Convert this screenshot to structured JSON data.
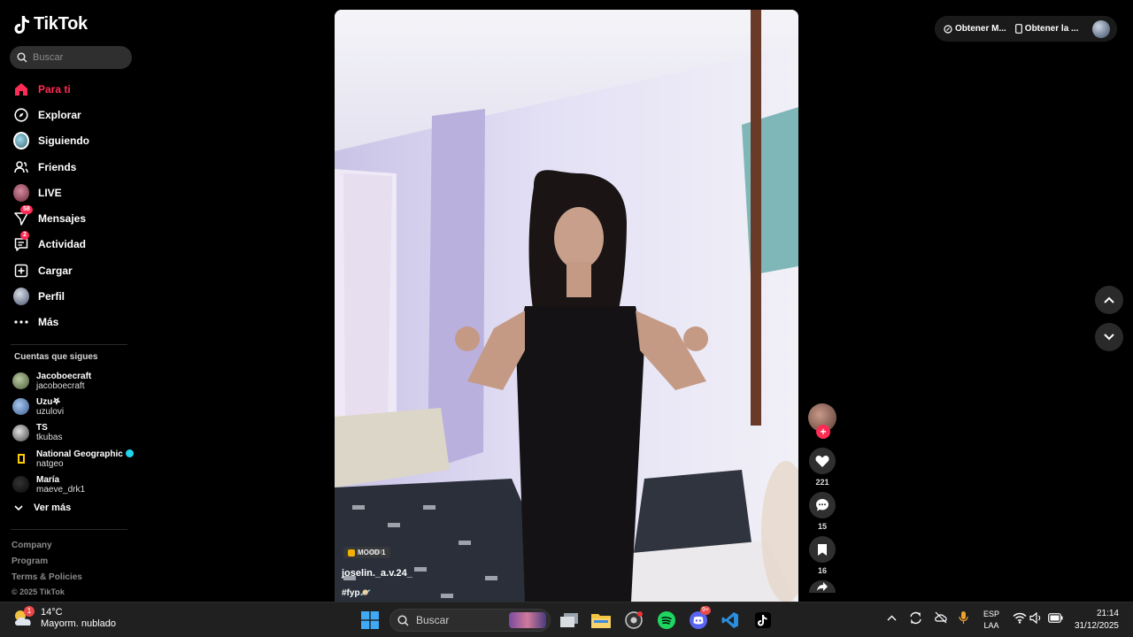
{
  "brand": {
    "name": "TikTok",
    "accent": "#fe2c55"
  },
  "search": {
    "placeholder": "Buscar"
  },
  "nav": [
    {
      "label": "Para ti",
      "icon": "home-icon",
      "active": true
    },
    {
      "label": "Explorar",
      "icon": "compass-icon"
    },
    {
      "label": "Siguiendo",
      "icon": "following-avatar-icon"
    },
    {
      "label": "Friends",
      "icon": "friends-icon"
    },
    {
      "label": "LIVE",
      "icon": "live-avatar-icon"
    },
    {
      "label": "Mensajes",
      "icon": "messages-icon",
      "badge": "58"
    },
    {
      "label": "Actividad",
      "icon": "activity-icon",
      "badge": "2"
    },
    {
      "label": "Cargar",
      "icon": "upload-icon"
    },
    {
      "label": "Perfil",
      "icon": "profile-avatar-icon"
    },
    {
      "label": "Más",
      "icon": "more-dots-icon"
    }
  ],
  "following": {
    "title": "Cuentas que sigues",
    "accounts": [
      {
        "name": "Jacoboecraft",
        "handle": "jacoboecraft"
      },
      {
        "name": "Uzu𖤐",
        "handle": "uzulovi"
      },
      {
        "name": "TS",
        "handle": "tkubas"
      },
      {
        "name": "National Geographic",
        "handle": "natgeo",
        "verified": true
      },
      {
        "name": "María",
        "handle": "maeve_drk1"
      }
    ],
    "see_more": "Ver más"
  },
  "footer": {
    "links": [
      "Company",
      "Program",
      "Terms & Policies"
    ],
    "copyright": "© 2025 TikTok"
  },
  "video": {
    "music_tag": "MOOD 1",
    "username": "joselin._a.v.24_",
    "caption": "#fyp🪐"
  },
  "actions": {
    "follow_plus": "+",
    "likes": "221",
    "comments": "15",
    "saves": "16"
  },
  "topbar": {
    "get_coins": "Obtener M...",
    "get_app": "Obtener la ..."
  },
  "taskbar": {
    "weather_temp": "14°C",
    "weather_desc": "Mayorm. nublado",
    "weather_badge": "1",
    "search_label": "Buscar",
    "discord_badge": "9+",
    "lang_line1": "ESP",
    "lang_line2": "LAA",
    "time": "21:14",
    "date": "31/12/2025"
  }
}
